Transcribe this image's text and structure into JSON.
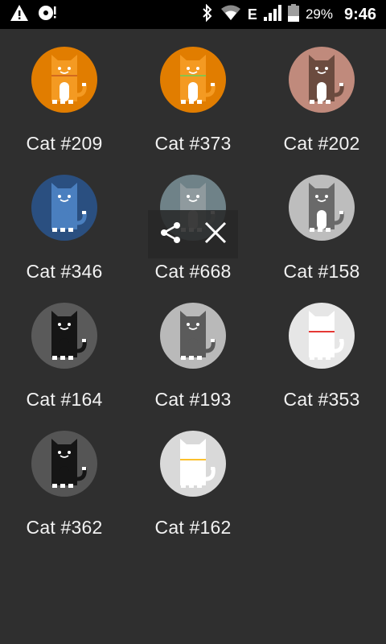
{
  "status_bar": {
    "battery_percent": "29%",
    "time": "9:46",
    "network_type": "E",
    "icons": [
      "warning-icon",
      "sd-card-alert-icon",
      "bluetooth-icon",
      "wifi-icon",
      "signal-icon",
      "battery-icon"
    ]
  },
  "cats": [
    {
      "label": "Cat #209",
      "bg": "#e17d00",
      "body": "#f49a22",
      "belly": "#ffffff",
      "collar": "#d2691e"
    },
    {
      "label": "Cat #373",
      "bg": "#e17d00",
      "body": "#f49a22",
      "belly": "#ffffff",
      "collar": "#8bc34a"
    },
    {
      "label": "Cat #202",
      "bg": "#c08a7c",
      "body": "#6b4b3f",
      "belly": "#ffffff",
      "collar": "#6b4b3f"
    },
    {
      "label": "Cat #346",
      "bg": "#2a4f80",
      "body": "#4a7fbf",
      "belly": "#4a7fbf",
      "collar": "#4a7fbf"
    },
    {
      "label": "Cat #668",
      "bg": "#6f8288",
      "body": "#8f9a9e",
      "belly": "#cccccc",
      "collar": "#8f9a9e"
    },
    {
      "label": "Cat #158",
      "bg": "#bdbdbd",
      "body": "#6a6a6a",
      "belly": "#ffffff",
      "collar": "#6a6a6a"
    },
    {
      "label": "Cat #164",
      "bg": "#5a5a5a",
      "body": "#151515",
      "belly": "#151515",
      "collar": "#151515"
    },
    {
      "label": "Cat #193",
      "bg": "#b9b9b9",
      "body": "#5b5b5b",
      "belly": "#5b5b5b",
      "collar": "#5b5b5b"
    },
    {
      "label": "Cat #353",
      "bg": "#e6e6e6",
      "body": "#ffffff",
      "belly": "#ffffff",
      "collar": "#e53935"
    },
    {
      "label": "Cat #362",
      "bg": "#555555",
      "body": "#151515",
      "belly": "#151515",
      "collar": "#151515"
    },
    {
      "label": "Cat #162",
      "bg": "#d9d9d9",
      "body": "#ffffff",
      "belly": "#ffffff",
      "collar": "#fbc02d"
    }
  ],
  "action_bar": {
    "buttons": [
      "share-icon",
      "close-icon"
    ]
  }
}
